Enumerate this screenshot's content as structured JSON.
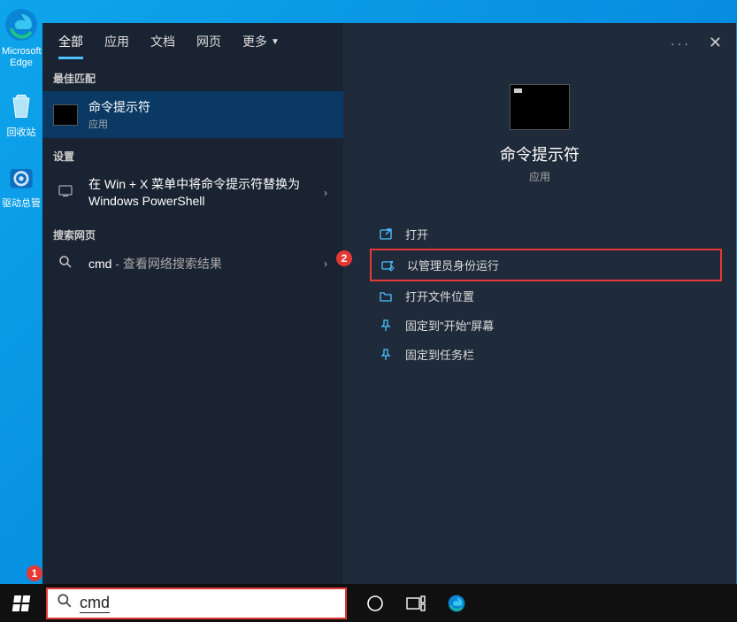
{
  "desktop": {
    "icons": [
      {
        "label": "Microsoft Edge"
      },
      {
        "label": "回收站"
      },
      {
        "label": "驱动总管"
      }
    ]
  },
  "start": {
    "tabs": {
      "all": "全部",
      "apps": "应用",
      "docs": "文档",
      "web": "网页",
      "more": "更多"
    },
    "best_match_label": "最佳匹配",
    "best_match": {
      "title": "命令提示符",
      "subtitle": "应用"
    },
    "settings_label": "设置",
    "setting_item": "在 Win + X 菜单中将命令提示符替换为 Windows PowerShell",
    "web_label": "搜索网页",
    "web_item": {
      "query": "cmd",
      "suffix": " - 查看网络搜索结果"
    }
  },
  "preview": {
    "title": "命令提示符",
    "subtitle": "应用",
    "actions": {
      "open": "打开",
      "run_admin": "以管理员身份运行",
      "open_location": "打开文件位置",
      "pin_start": "固定到\"开始\"屏幕",
      "pin_taskbar": "固定到任务栏"
    }
  },
  "search": {
    "value": "cmd"
  },
  "annotations": {
    "badge1": "1",
    "badge2": "2"
  }
}
